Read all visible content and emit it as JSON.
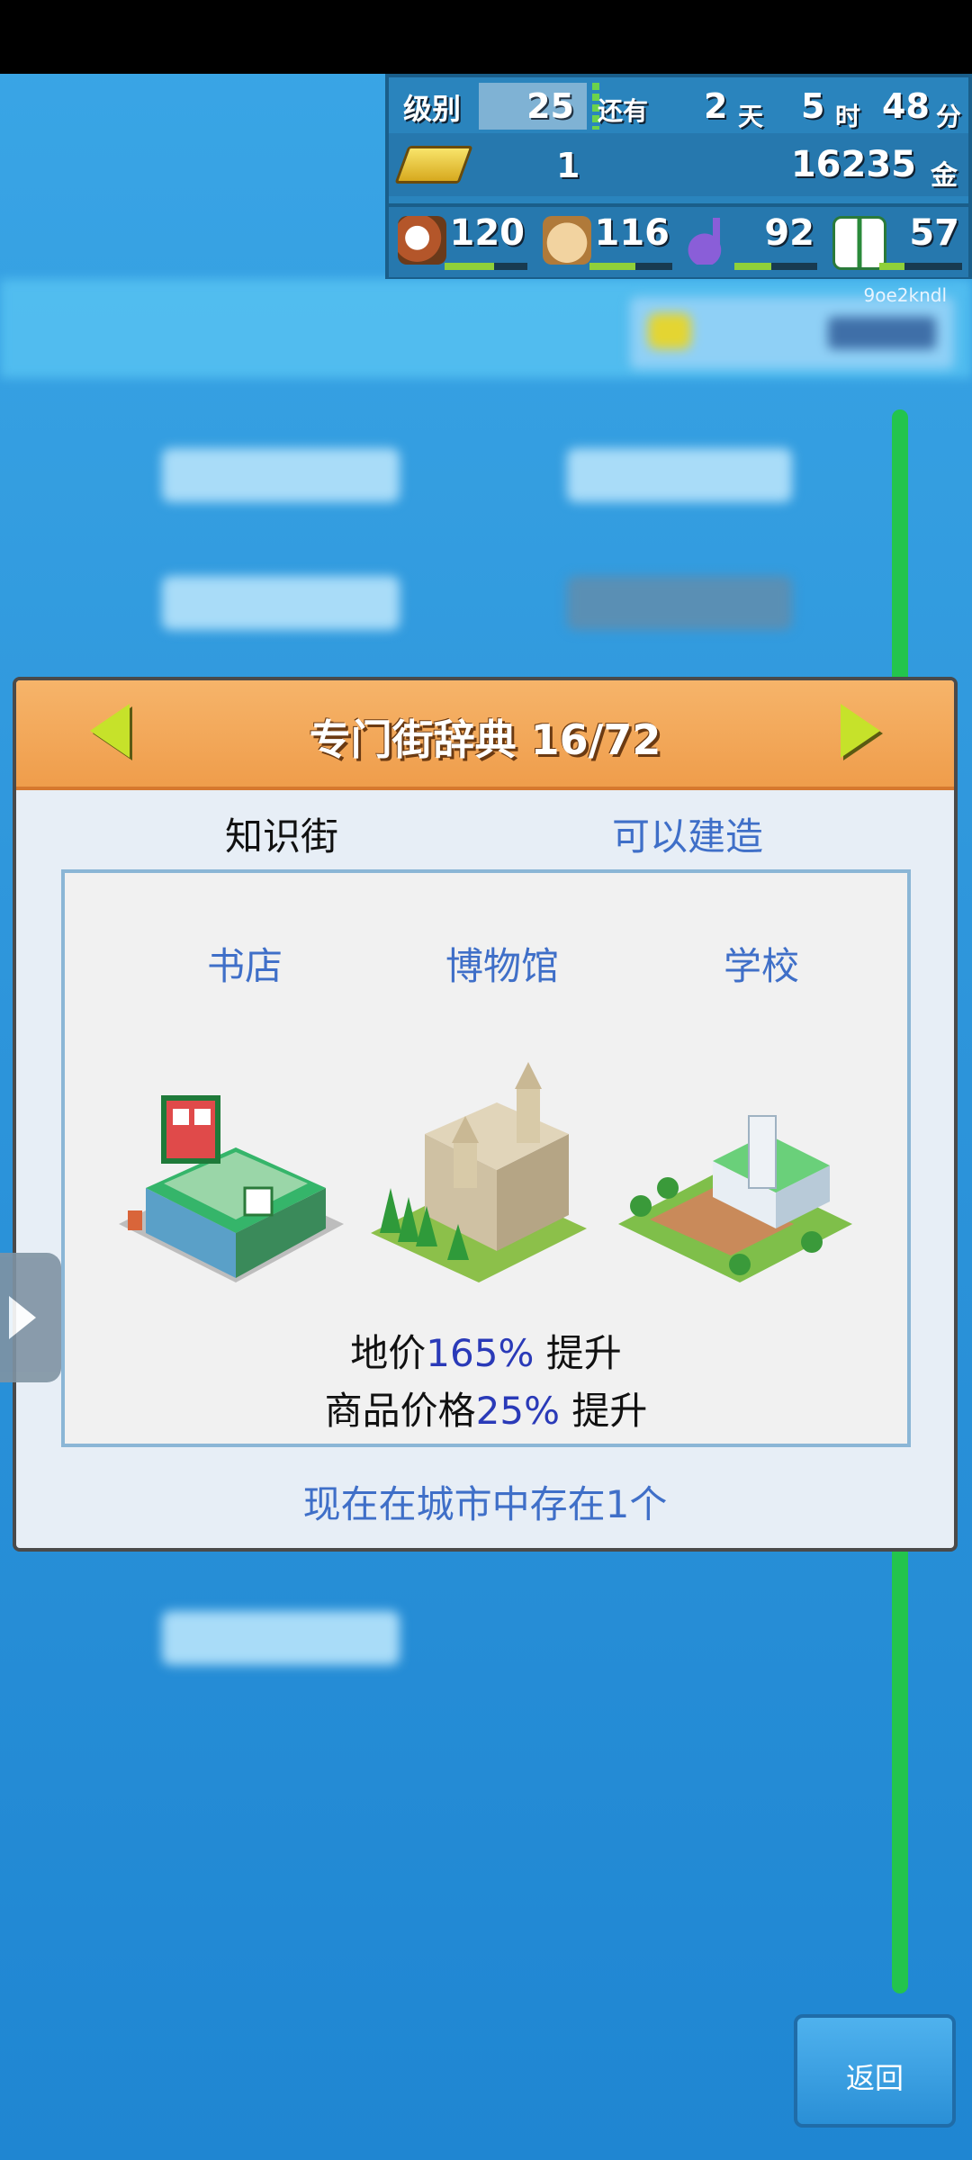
{
  "status": {
    "level_label": "级别",
    "level_value": "25",
    "remaining_label": "还有",
    "days": "2",
    "days_unit": "天",
    "hours": "5",
    "hours_unit": "时",
    "minutes": "48",
    "minutes_unit": "分",
    "gold_bars": "1",
    "money": "16235",
    "money_unit": "金",
    "stats": [
      {
        "icon": "food-icon",
        "value": "120",
        "level": 0.6
      },
      {
        "icon": "bag-icon",
        "value": "116",
        "level": 0.55
      },
      {
        "icon": "music-note-icon",
        "value": "92",
        "level": 0.45
      },
      {
        "icon": "book-icon",
        "value": "57",
        "level": 0.3
      }
    ]
  },
  "watermark_code": "9oe2kndl",
  "dialog": {
    "title": "专门街辞典 16/72",
    "street_name": "知识街",
    "build_status": "可以建造",
    "buildings": [
      "书店",
      "博物馆",
      "学校"
    ],
    "effect1_prefix": "地价",
    "effect1_value": "165%",
    "effect1_suffix": " 提升",
    "effect2_prefix": "商品价格",
    "effect2_value": "25%",
    "effect2_suffix": " 提升",
    "existing_text": "现在在城市中存在1个"
  },
  "back_button": "返回",
  "colors": {
    "accent_orange": "#ef9d4b",
    "link_blue": "#3f6fc8",
    "value_blue": "#2a3ab8",
    "arrow_green": "#c6e22a"
  }
}
